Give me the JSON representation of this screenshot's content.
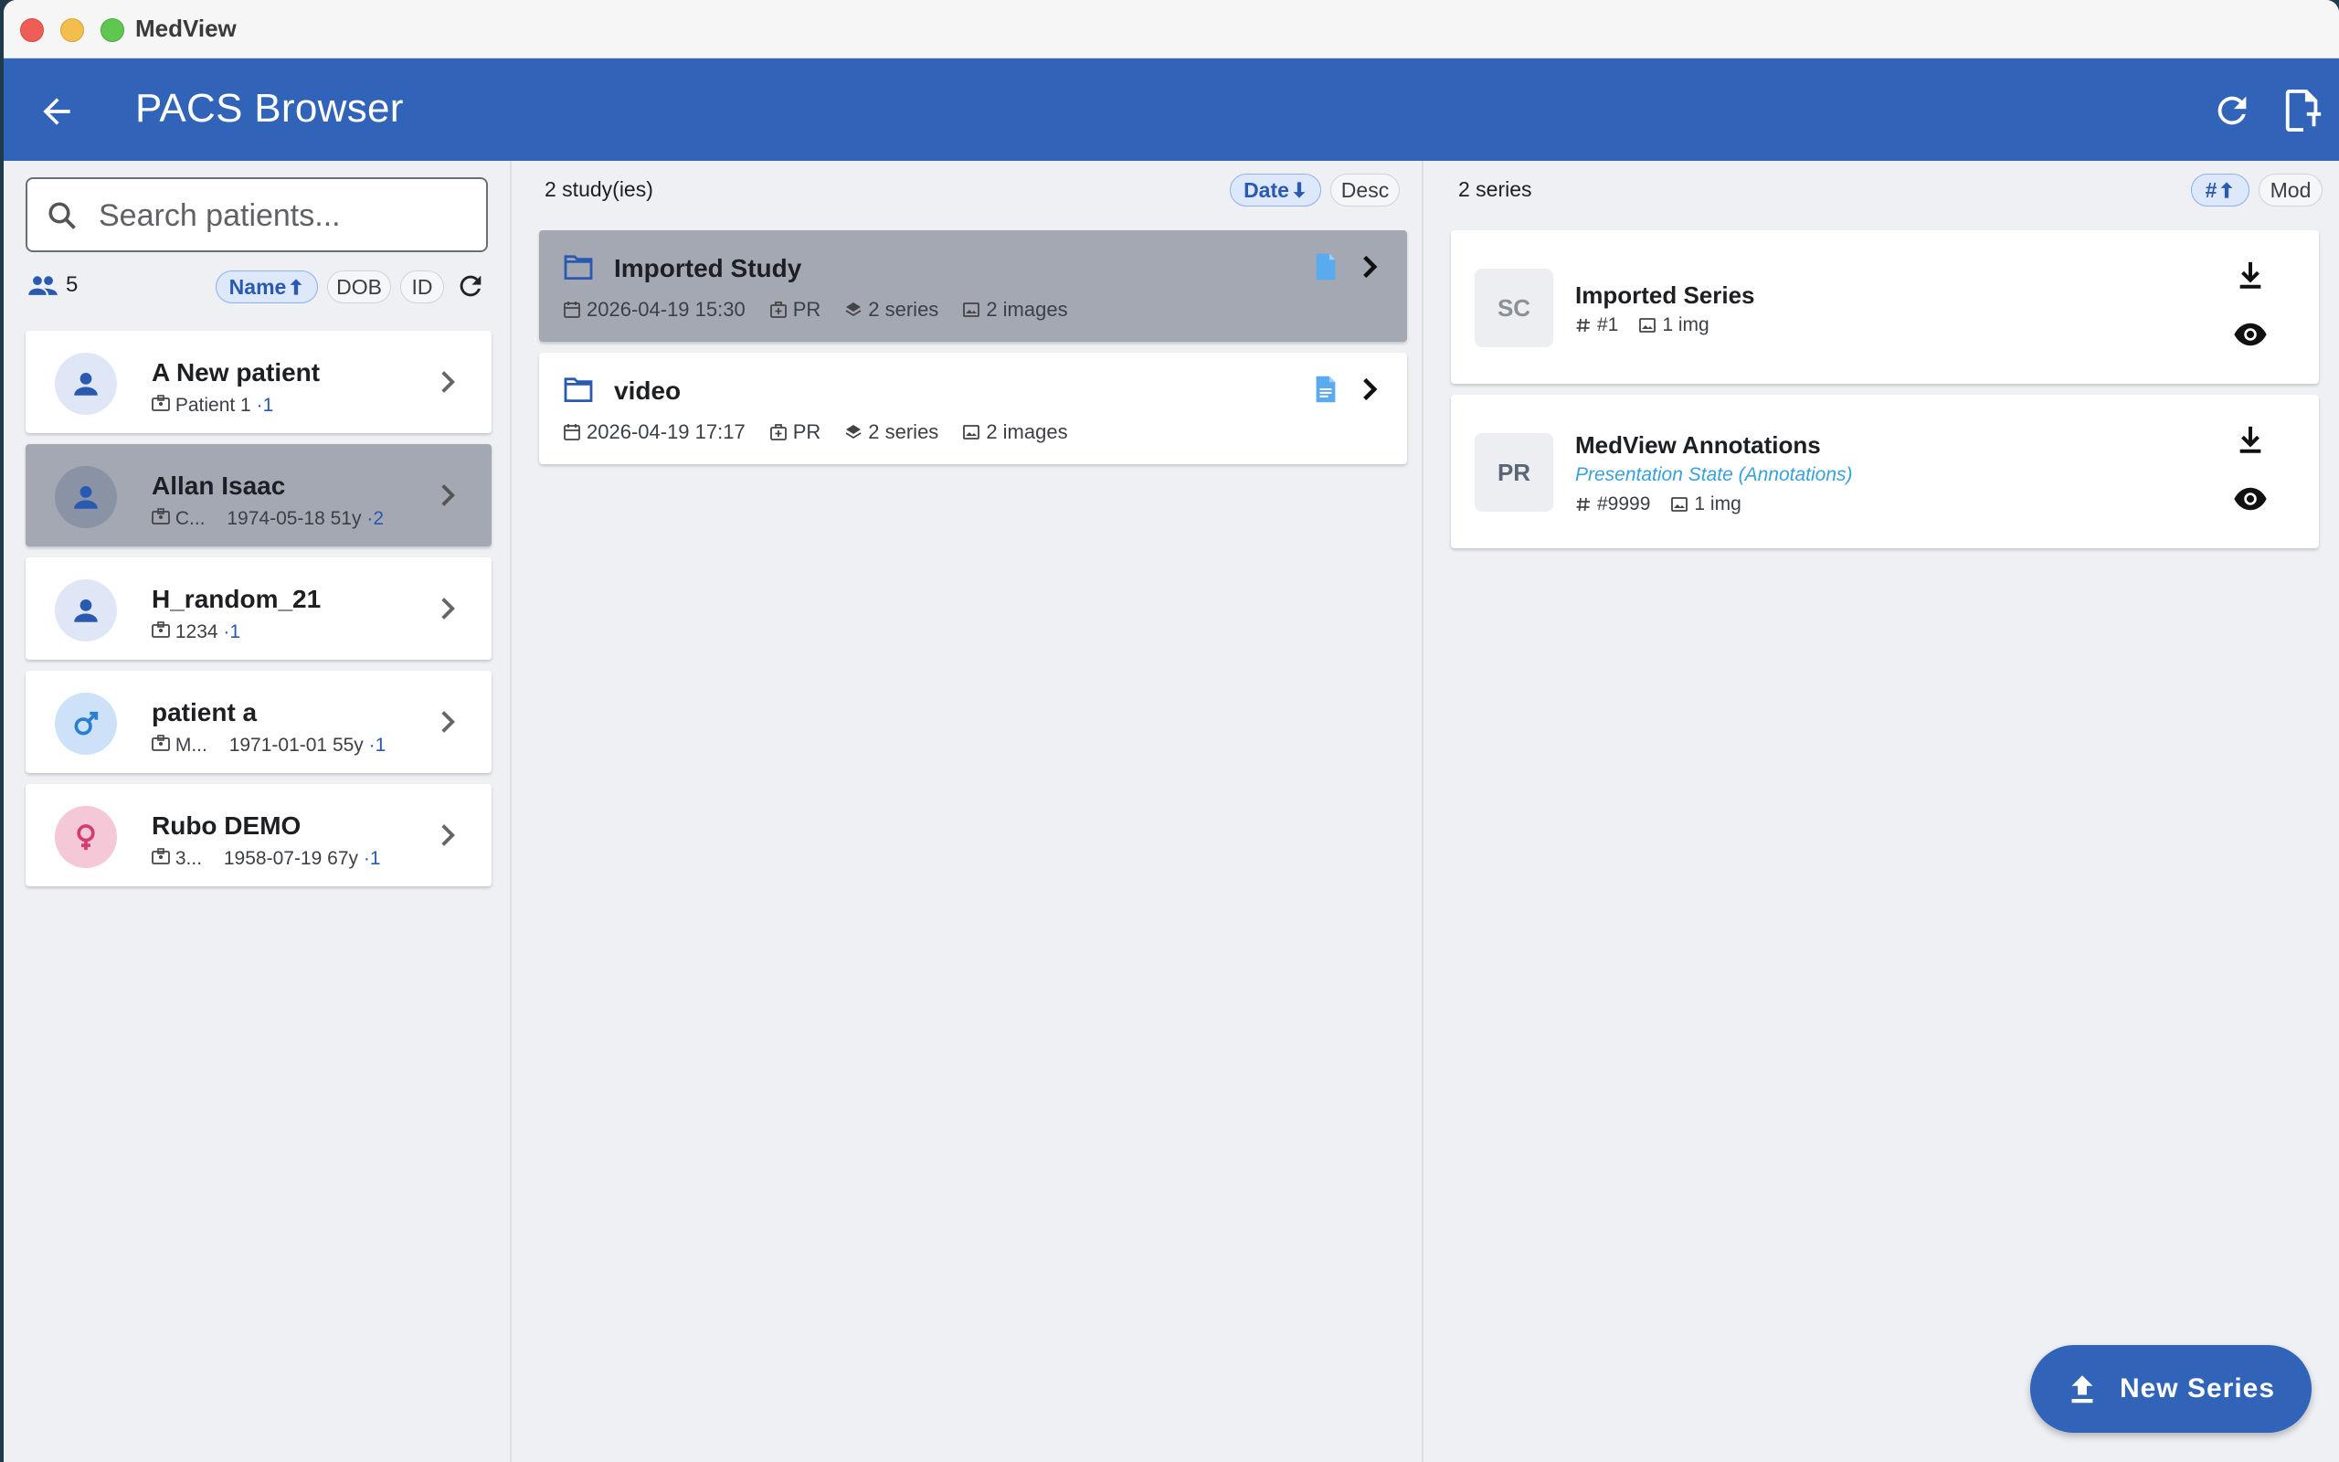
{
  "window": {
    "title": "MedView"
  },
  "appbar": {
    "title": "PACS Browser"
  },
  "patients": {
    "search_placeholder": "Search patients...",
    "count": "5",
    "sort": {
      "name": "Name",
      "dob": "DOB",
      "id": "ID"
    },
    "items": [
      {
        "name": "A New patient",
        "id": "Patient 1",
        "dob": "",
        "age": "",
        "studies": "·1",
        "icon": "person-icon"
      },
      {
        "name": "Allan Isaac",
        "id": "C...",
        "dob": "1974-05-18",
        "age": "51y",
        "studies": "·2",
        "icon": "person-icon"
      },
      {
        "name": "H_random_21",
        "id": "1234",
        "dob": "",
        "age": "",
        "studies": "·1",
        "icon": "person-icon"
      },
      {
        "name": "patient a",
        "id": "M...",
        "dob": "1971-01-01",
        "age": "55y",
        "studies": "·1",
        "icon": "male-icon"
      },
      {
        "name": "Rubo DEMO",
        "id": "3...",
        "dob": "1958-07-19",
        "age": "67y",
        "studies": "·1",
        "icon": "female-icon"
      }
    ]
  },
  "studies": {
    "count_label": "2 study(ies)",
    "sort": {
      "date": "Date",
      "desc": "Desc"
    },
    "items": [
      {
        "title": "Imported Study",
        "datetime": "2026-04-19 15:30",
        "modality": "PR",
        "series": "2 series",
        "images": "2 images"
      },
      {
        "title": "video",
        "datetime": "2026-04-19 17:17",
        "modality": "PR",
        "series": "2 series",
        "images": "2 images"
      }
    ]
  },
  "series": {
    "count_label": "2 series",
    "sort": {
      "num": "#",
      "mod": "Mod"
    },
    "items": [
      {
        "modality": "SC",
        "title": "Imported Series",
        "subtitle": "",
        "number": "#1",
        "images": "1 img"
      },
      {
        "modality": "PR",
        "title": "MedView Annotations",
        "subtitle": "Presentation State (Annotations)",
        "number": "#9999",
        "images": "1 img"
      }
    ]
  },
  "fab": {
    "label": "New Series"
  },
  "colors": {
    "primary": "#3163b8",
    "selected": "#a3a8b3",
    "accent_link": "#3aa0d8"
  }
}
